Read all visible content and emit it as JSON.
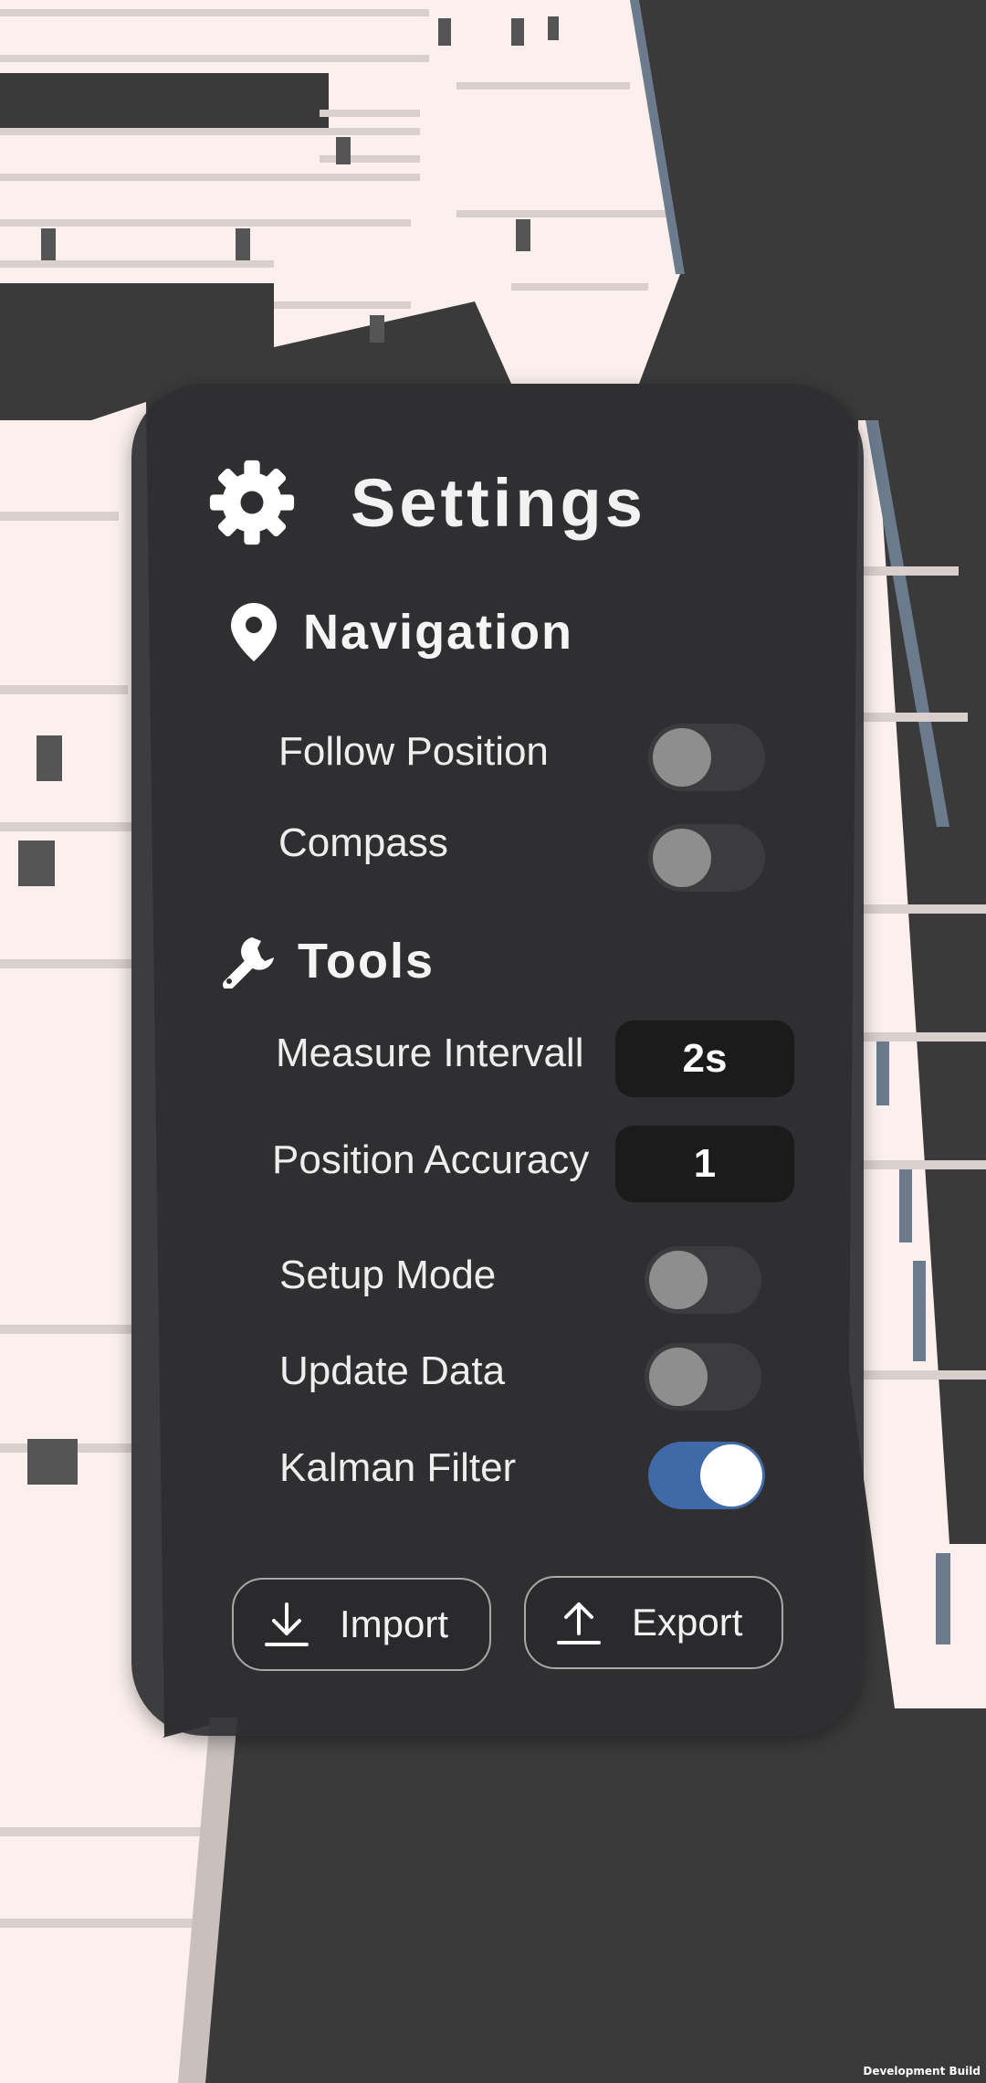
{
  "settings": {
    "title": "Settings",
    "navigation": {
      "title": "Navigation",
      "follow_position": {
        "label": "Follow Position",
        "enabled": false
      },
      "compass": {
        "label": "Compass",
        "enabled": false
      }
    },
    "tools": {
      "title": "Tools",
      "measure_interval": {
        "label": "Measure Intervall",
        "value": "2s"
      },
      "position_accuracy": {
        "label": "Position Accuracy",
        "value": "1"
      },
      "setup_mode": {
        "label": "Setup Mode",
        "enabled": false
      },
      "update_data": {
        "label": "Update Data",
        "enabled": false
      },
      "kalman_filter": {
        "label": "Kalman Filter",
        "enabled": true
      }
    },
    "buttons": {
      "import_label": "Import",
      "export_label": "Export"
    }
  },
  "footer": {
    "build_label": "Development Build"
  },
  "icons": {
    "title": "gear-icon",
    "navigation": "map-pin-icon",
    "tools": "wrench-icon",
    "import": "download-icon",
    "export": "upload-icon"
  },
  "colors": {
    "toggle_on": "#3f6aa7",
    "panel": "#2e2e30",
    "value_box": "#1b1b1b"
  }
}
